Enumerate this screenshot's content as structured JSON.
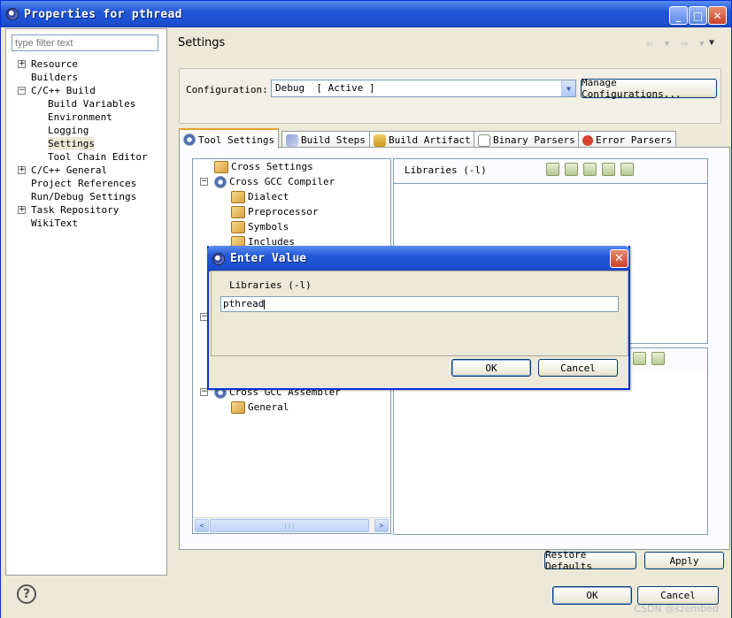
{
  "window": {
    "title": "Properties for pthread",
    "min_btn": "_",
    "max_btn": "□",
    "close_btn": "✕"
  },
  "left": {
    "filter_placeholder": "type filter text",
    "tree": [
      {
        "label": "Resource",
        "expander": "+"
      },
      {
        "label": "Builders"
      },
      {
        "label": "C/C++ Build",
        "expander": "−"
      },
      {
        "label": "Build Variables"
      },
      {
        "label": "Environment"
      },
      {
        "label": "Logging"
      },
      {
        "label": "Settings"
      },
      {
        "label": "Tool Chain Editor"
      },
      {
        "label": "C/C++ General",
        "expander": "+"
      },
      {
        "label": "Project References"
      },
      {
        "label": "Run/Debug Settings"
      },
      {
        "label": "Task Repository",
        "expander": "+"
      },
      {
        "label": "WikiText"
      }
    ]
  },
  "main": {
    "page_title": "Settings",
    "nav_arrows": "⇦ ▾ ⇨ ▾",
    "nav_menu": "▼",
    "config_label": "Configuration:",
    "config_value": "Debug  [ Active ]",
    "manage_button": "Manage Configurations...",
    "tabs": [
      {
        "label": "Tool Settings"
      },
      {
        "label": "Build Steps"
      },
      {
        "label": "Build Artifact"
      },
      {
        "label": "Binary Parsers"
      },
      {
        "label": "Error Parsers"
      }
    ],
    "tool_tree": [
      {
        "label": "Cross Settings"
      },
      {
        "label": "Cross GCC Compiler",
        "expander": "−"
      },
      {
        "label": "Dialect"
      },
      {
        "label": "Preprocessor"
      },
      {
        "label": "Symbols"
      },
      {
        "label": "Includes"
      },
      {
        "label": "Cross GCC Assembler",
        "expander": "−"
      },
      {
        "label": "General"
      }
    ],
    "libraries_header": "Libraries (-l)",
    "scroll_left": "<",
    "scroll_right": ">",
    "scroll_grip": "|||",
    "restore_defaults": "Restore Defaults",
    "apply": "Apply"
  },
  "dialog": {
    "title": "Enter Value",
    "close": "✕",
    "label": "Libraries (-l)",
    "value": "pthread",
    "ok": "OK",
    "cancel": "Cancel"
  },
  "footer": {
    "help": "?",
    "ok": "OK",
    "cancel": "Cancel",
    "watermark": "CSDN @szembed"
  },
  "colors": {
    "titlebar": "#2157d8",
    "window_bg": "#ece9d8",
    "active_tab_accent": "#e8a02e"
  }
}
